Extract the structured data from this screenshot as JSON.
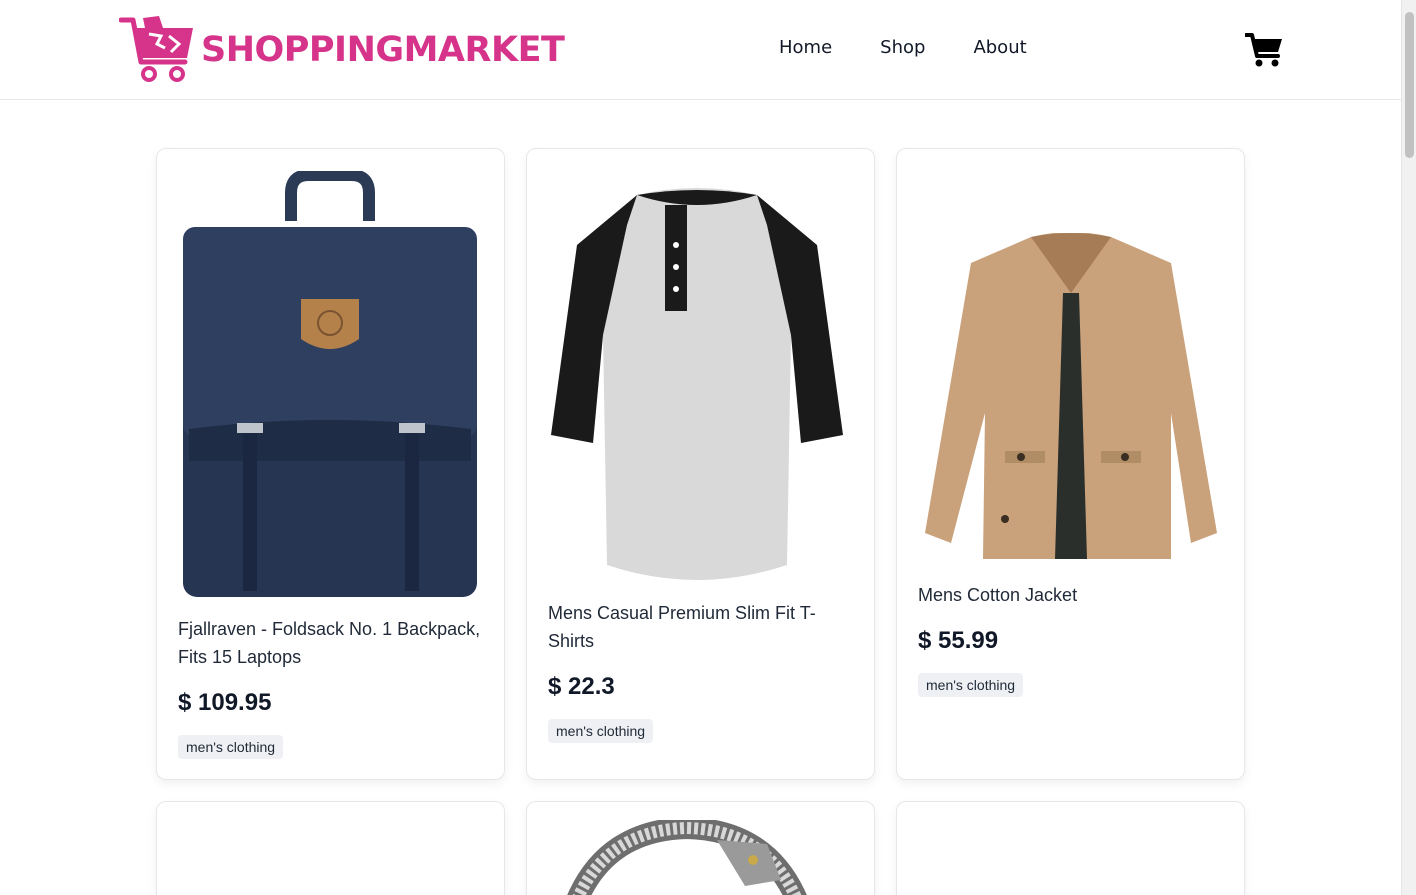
{
  "header": {
    "brand_name": "SHOPPINGMARKET",
    "nav": [
      {
        "label": "Home"
      },
      {
        "label": "Shop"
      },
      {
        "label": "About"
      }
    ],
    "cart_icon": "shopping-cart-icon"
  },
  "colors": {
    "brand": "#d6338a",
    "text": "#1f2937",
    "tag_bg": "#eef0f3"
  },
  "products": [
    {
      "title": "Fjallraven - Foldsack No. 1 Backpack, Fits 15 Laptops",
      "price": "$ 109.95",
      "category": "men's clothing",
      "image": "navy backpack"
    },
    {
      "title": "Mens Casual Premium Slim Fit T-Shirts",
      "price": "$ 22.3",
      "category": "men's clothing",
      "image": "raglan henley t-shirt"
    },
    {
      "title": "Mens Cotton Jacket",
      "price": "$ 55.99",
      "category": "men's clothing",
      "image": "khaki cotton jacket"
    },
    {
      "title": "",
      "price": "",
      "category": "",
      "image": ""
    },
    {
      "title": "",
      "price": "",
      "category": "",
      "image": "silver chain bracelet"
    },
    {
      "title": "",
      "price": "",
      "category": "",
      "image": ""
    }
  ]
}
